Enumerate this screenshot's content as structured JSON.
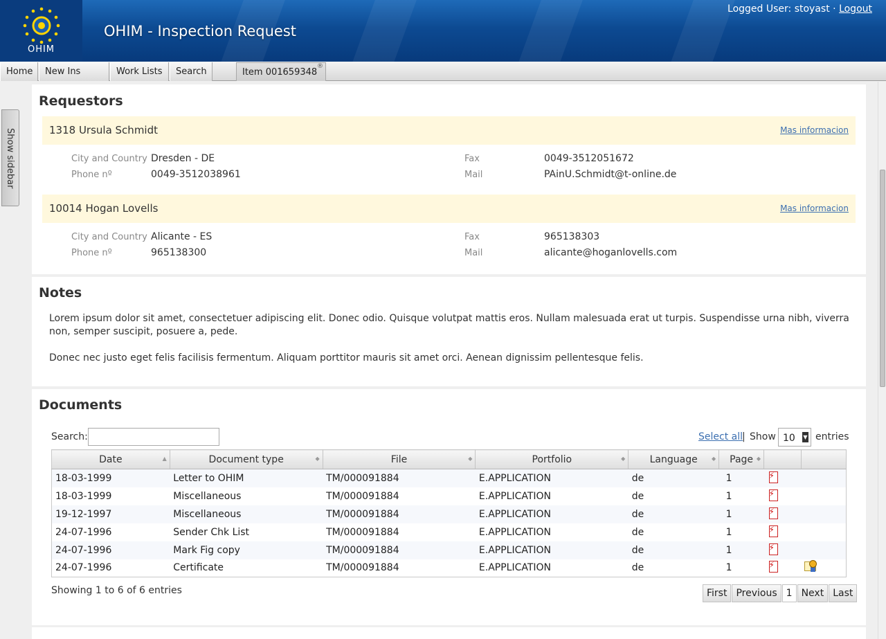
{
  "header": {
    "logo_text": "OHIM",
    "title": "OHIM - Inspection Request",
    "user_label": "Logged User: stoyast ·",
    "logout": "Logout"
  },
  "tabs": [
    {
      "label": "Home"
    },
    {
      "label": "New Ins Req."
    },
    {
      "label": "Work Lists"
    },
    {
      "label": "Search"
    },
    {
      "label": "Item 001659348"
    }
  ],
  "sidebar": {
    "toggle_label": "Show sidebar"
  },
  "requestors": {
    "title": "Requestors",
    "more_label": "Mas informacion",
    "labels": {
      "city": "City and Country",
      "phone": "Phone nº",
      "fax": "Fax",
      "mail": "Mail"
    },
    "items": [
      {
        "name": "1318 Ursula Schmidt",
        "city": "Dresden - DE",
        "phone": "0049-3512038961",
        "fax": "0049-3512051672",
        "mail": "PAinU.Schmidt@t-online.de"
      },
      {
        "name": "10014 Hogan Lovells",
        "city": "Alicante - ES",
        "phone": "965138300",
        "fax": "965138303",
        "mail": "alicante@hoganlovells.com"
      }
    ]
  },
  "notes": {
    "title": "Notes",
    "paragraphs": [
      "Lorem ipsum dolor sit amet, consectetuer adipiscing elit. Donec odio. Quisque volutpat mattis eros. Nullam malesuada erat ut turpis. Suspendisse urna nibh, viverra non, semper suscipit, posuere a, pede.",
      "Donec nec justo eget felis facilisis fermentum. Aliquam porttitor mauris sit amet orci. Aenean dignissim pellentesque felis."
    ]
  },
  "documents": {
    "title": "Documents",
    "search_label": "Search:",
    "search_value": "",
    "select_all": "Select all",
    "separator": "|",
    "show_label": "Show",
    "entries_value": "10",
    "entries_label": "entries",
    "columns": [
      "Date",
      "Document type",
      "File",
      "Portfolio",
      "Language",
      "Page",
      "",
      ""
    ],
    "rows": [
      {
        "date": "18-03-1999",
        "type": "Letter to OHIM",
        "file": "TM/000091884",
        "portfolio": "E.APPLICATION",
        "lang": "de",
        "page": "1",
        "pdf_icon": "pdf-icon",
        "cert_icon": ""
      },
      {
        "date": "18-03-1999",
        "type": "Miscellaneous",
        "file": "TM/000091884",
        "portfolio": "E.APPLICATION",
        "lang": "de",
        "page": "1",
        "pdf_icon": "pdf-icon",
        "cert_icon": ""
      },
      {
        "date": "19-12-1997",
        "type": "Miscellaneous",
        "file": "TM/000091884",
        "portfolio": "E.APPLICATION",
        "lang": "de",
        "page": "1",
        "pdf_icon": "pdf-icon",
        "cert_icon": ""
      },
      {
        "date": "24-07-1996",
        "type": "Sender Chk List",
        "file": "TM/000091884",
        "portfolio": "E.APPLICATION",
        "lang": "de",
        "page": "1",
        "pdf_icon": "pdf-icon",
        "cert_icon": ""
      },
      {
        "date": "24-07-1996",
        "type": "Mark Fig copy",
        "file": "TM/000091884",
        "portfolio": "E.APPLICATION",
        "lang": "de",
        "page": "1",
        "pdf_icon": "pdf-icon",
        "cert_icon": ""
      },
      {
        "date": "24-07-1996",
        "type": "Certificate",
        "file": "TM/000091884",
        "portfolio": "E.APPLICATION",
        "lang": "de",
        "page": "1",
        "pdf_icon": "pdf-icon",
        "cert_icon": "certificate-icon"
      }
    ],
    "info": "Showing 1 to 6 of 6 entries",
    "pager": {
      "first": "First",
      "previous": "Previous",
      "current": "1",
      "next": "Next",
      "last": "Last"
    }
  }
}
